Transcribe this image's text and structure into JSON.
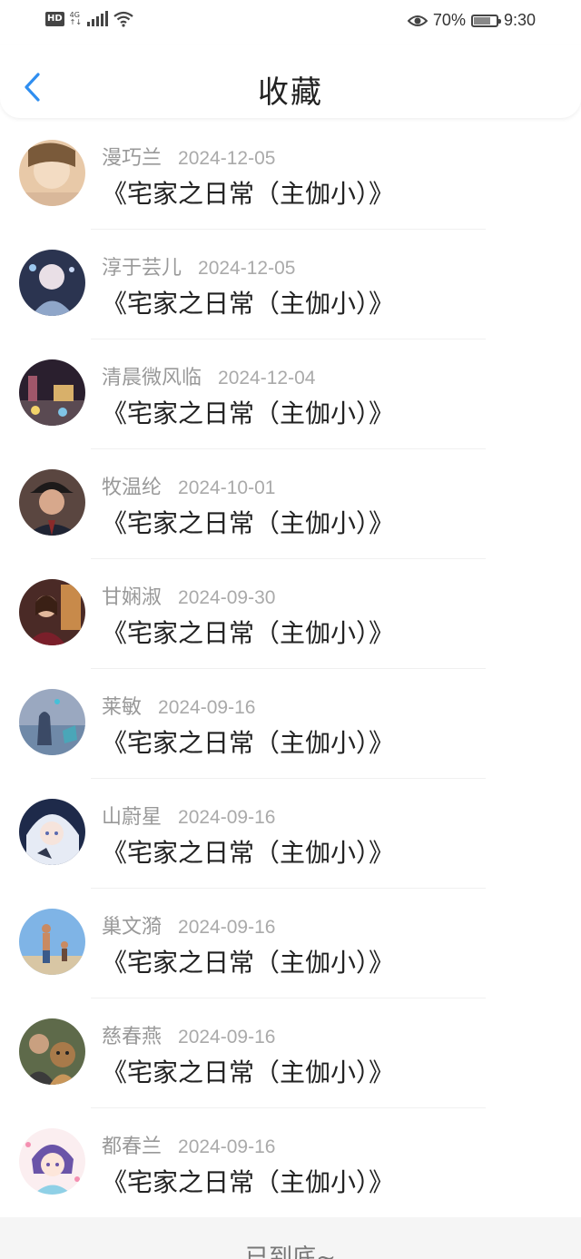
{
  "status_bar": {
    "hd": "HD",
    "network": "4G",
    "battery_percent": "70%",
    "battery_level": 0.7,
    "time": "9:30"
  },
  "header": {
    "title": "收藏",
    "back_icon": "chevron-left-icon",
    "accent": "#2f8ef0"
  },
  "favorites": [
    {
      "name": "漫巧兰",
      "date": "2024-12-05",
      "book": "《宅家之日常（主伽小）》"
    },
    {
      "name": "淳于芸儿",
      "date": "2024-12-05",
      "book": "《宅家之日常（主伽小）》"
    },
    {
      "name": "清晨微风临",
      "date": "2024-12-04",
      "book": "《宅家之日常（主伽小）》"
    },
    {
      "name": "牧温纶",
      "date": "2024-10-01",
      "book": "《宅家之日常（主伽小）》"
    },
    {
      "name": "甘娴淑",
      "date": "2024-09-30",
      "book": "《宅家之日常（主伽小）》"
    },
    {
      "name": "莱敏",
      "date": "2024-09-16",
      "book": "《宅家之日常（主伽小）》"
    },
    {
      "name": "山蔚星",
      "date": "2024-09-16",
      "book": "《宅家之日常（主伽小）》"
    },
    {
      "name": "巢文漪",
      "date": "2024-09-16",
      "book": "《宅家之日常（主伽小）》"
    },
    {
      "name": "慈春燕",
      "date": "2024-09-16",
      "book": "《宅家之日常（主伽小）》"
    },
    {
      "name": "都春兰",
      "date": "2024-09-16",
      "book": "《宅家之日常（主伽小）》"
    }
  ],
  "footer": {
    "text": "已到底~"
  }
}
